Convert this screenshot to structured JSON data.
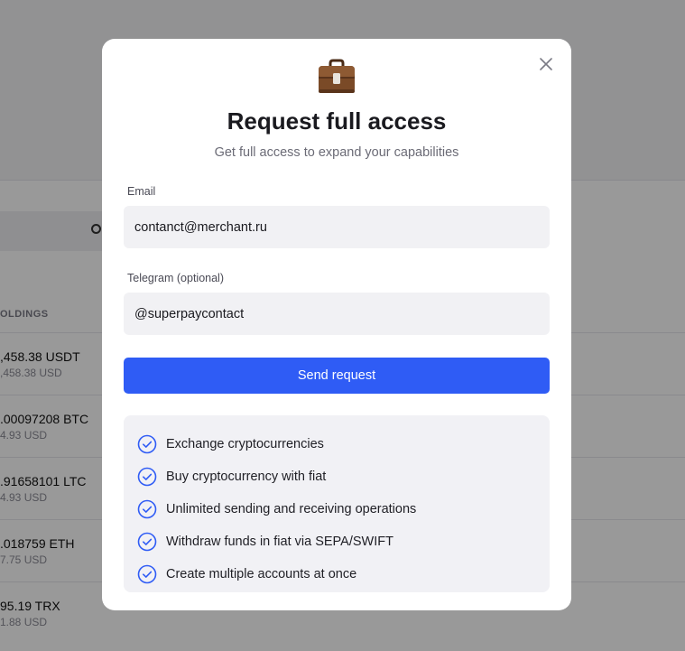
{
  "background": {
    "holdings_header": "OLDINGS",
    "rows": [
      {
        "amount": ",458.38 USDT",
        "fiat": ",458.38 USD"
      },
      {
        "amount": ".00097208 BTC",
        "fiat": "4.93 USD"
      },
      {
        "amount": ".91658101 LTC",
        "fiat": "4.93 USD"
      },
      {
        "amount": ".018759 ETH",
        "fiat": "7.75 USD"
      },
      {
        "amount": "95.19 TRX",
        "fiat": "1.88 USD"
      }
    ]
  },
  "modal": {
    "title": "Request full access",
    "subtitle": "Get full access to expand your capabilities",
    "email_label": "Email",
    "email_value": "contanct@merchant.ru",
    "telegram_label": "Telegram (optional)",
    "telegram_value": "@superpaycontact",
    "send_label": "Send request",
    "features": [
      "Exchange cryptocurrencies",
      "Buy cryptocurrency with fiat",
      "Unlimited sending and receiving operations",
      "Withdraw funds in fiat via SEPA/SWIFT",
      "Create multiple accounts at once"
    ]
  },
  "colors": {
    "accent": "#2f5cf5",
    "check": "#2f5cf5",
    "overlay": "rgba(0,0,0,0.40)"
  },
  "icons": {
    "header": "briefcase-icon",
    "close": "close-icon",
    "feature": "check-circle-icon",
    "search": "search-icon"
  }
}
